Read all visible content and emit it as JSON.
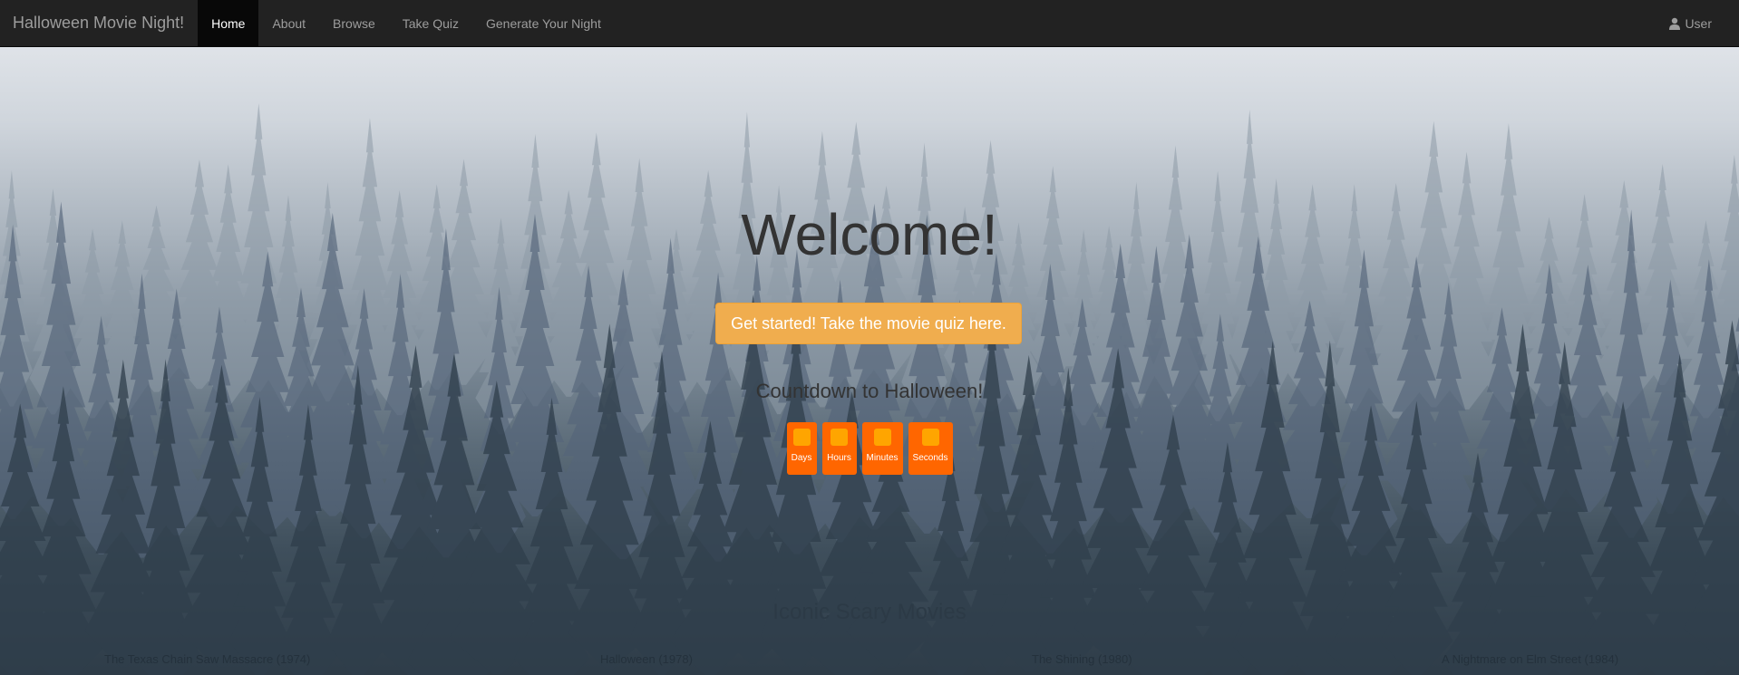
{
  "navbar": {
    "brand": "Halloween Movie Night!",
    "links": [
      {
        "label": "Home",
        "active": true
      },
      {
        "label": "About",
        "active": false
      },
      {
        "label": "Browse",
        "active": false
      },
      {
        "label": "Take Quiz",
        "active": false
      },
      {
        "label": "Generate Your Night",
        "active": false
      }
    ],
    "user": {
      "icon": "user-icon",
      "label": "User"
    }
  },
  "hero": {
    "welcome": "Welcome!",
    "cta_label": "Get started! Take the movie quiz here.",
    "countdown_title": "Countdown to Halloween!",
    "countdown": [
      {
        "label": "Days"
      },
      {
        "label": "Hours"
      },
      {
        "label": "Minutes"
      },
      {
        "label": "Seconds"
      }
    ]
  },
  "iconic": {
    "title": "Iconic Scary Movies",
    "movies": [
      "The Texas Chain Saw Massacre (1974)",
      "Halloween (1978)",
      "The Shining (1980)",
      "A Nightmare on Elm Street (1984)"
    ]
  },
  "colors": {
    "navbar_bg": "#222222",
    "active_tab_bg": "#080808",
    "cta_bg": "#f0ad4e",
    "countdown_box": "#ff6600",
    "countdown_digit": "#ffa500"
  }
}
